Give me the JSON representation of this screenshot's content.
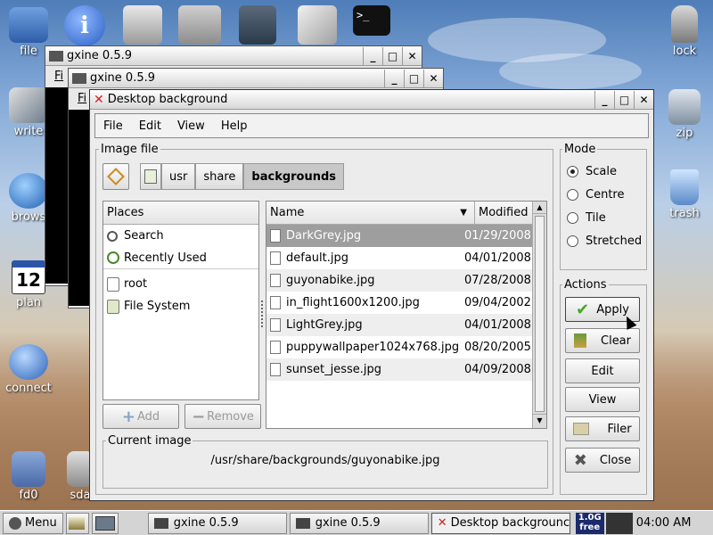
{
  "desktop": {
    "icons_left": [
      {
        "id": "file",
        "label": "file"
      },
      {
        "id": "write",
        "label": "write"
      },
      {
        "id": "browse",
        "label": "brows"
      },
      {
        "id": "plan",
        "label": "plan",
        "day": "12"
      },
      {
        "id": "connect",
        "label": "connect"
      },
      {
        "id": "fd0",
        "label": "fd0"
      },
      {
        "id": "sda",
        "label": "sda"
      }
    ],
    "icons_right": [
      {
        "id": "lock",
        "label": "lock"
      },
      {
        "id": "zip",
        "label": "zip"
      },
      {
        "id": "trash",
        "label": "trash"
      }
    ]
  },
  "bg_windows": [
    {
      "title": "gxine 0.5.9",
      "menu": "Fi"
    },
    {
      "title": "gxine 0.5.9",
      "menu": "Fi"
    }
  ],
  "window": {
    "title": "Desktop background",
    "menu": [
      "File",
      "Edit",
      "View",
      "Help"
    ],
    "image_file_label": "Image file",
    "path": [
      "usr",
      "share",
      "backgrounds"
    ],
    "places": {
      "header": "Places",
      "items": [
        "Search",
        "Recently Used",
        "root",
        "File System"
      ],
      "add": "Add",
      "remove": "Remove"
    },
    "files": {
      "col_name": "Name",
      "col_modified": "Modified",
      "rows": [
        {
          "name": "DarkGrey.jpg",
          "modified": "01/29/2008"
        },
        {
          "name": "default.jpg",
          "modified": "04/01/2008"
        },
        {
          "name": "guyonabike.jpg",
          "modified": "07/28/2008"
        },
        {
          "name": "in_flight1600x1200.jpg",
          "modified": "09/04/2002"
        },
        {
          "name": "LightGrey.jpg",
          "modified": "04/01/2008"
        },
        {
          "name": "puppywallpaper1024x768.jpg",
          "modified": "08/20/2005"
        },
        {
          "name": "sunset_jesse.jpg",
          "modified": "04/09/2008"
        }
      ]
    },
    "current_image_label": "Current image",
    "current_image": "/usr/share/backgrounds/guyonabike.jpg",
    "mode": {
      "label": "Mode",
      "options": [
        "Scale",
        "Centre",
        "Tile",
        "Stretched"
      ],
      "selected": "Scale"
    },
    "actions": {
      "label": "Actions",
      "apply": "Apply",
      "clear": "Clear",
      "edit": "Edit",
      "view": "View",
      "filer": "Filer",
      "close": "Close"
    }
  },
  "taskbar": {
    "menu": "Menu",
    "tasks": [
      "gxine 0.5.9",
      "gxine 0.5.9",
      "Desktop backgrounc"
    ],
    "badge_top": "1.0G",
    "badge_bottom": "free",
    "clock": "04:00 AM"
  },
  "colors": {
    "selected_row": "#9e9e9e",
    "close_x": "#cc2222",
    "apply_check": "#44aa22"
  }
}
